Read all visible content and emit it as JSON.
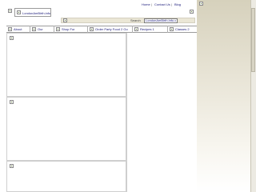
{
  "top_nav": {
    "home": "Home",
    "sep1": "|",
    "contact": "Contact Us",
    "sep2": "|",
    "blog": "Blog"
  },
  "logo": {
    "alt_text": "LondonAmBirth.info"
  },
  "search": {
    "label": "Search",
    "value": "LondonAmBirth.info.com"
  },
  "tabs": [
    {
      "label": "About"
    },
    {
      "label": "Our"
    },
    {
      "label": "Shop For"
    },
    {
      "label": "Order Party Food 2 Go"
    },
    {
      "label": "Recipes 1"
    },
    {
      "label": "Classes 2"
    }
  ],
  "colors": {
    "link": "#1a1a7a",
    "panel_top": "#d6d1bc",
    "search_bar": "#ebe7d6"
  },
  "icons": [
    "broken-image-icon"
  ]
}
